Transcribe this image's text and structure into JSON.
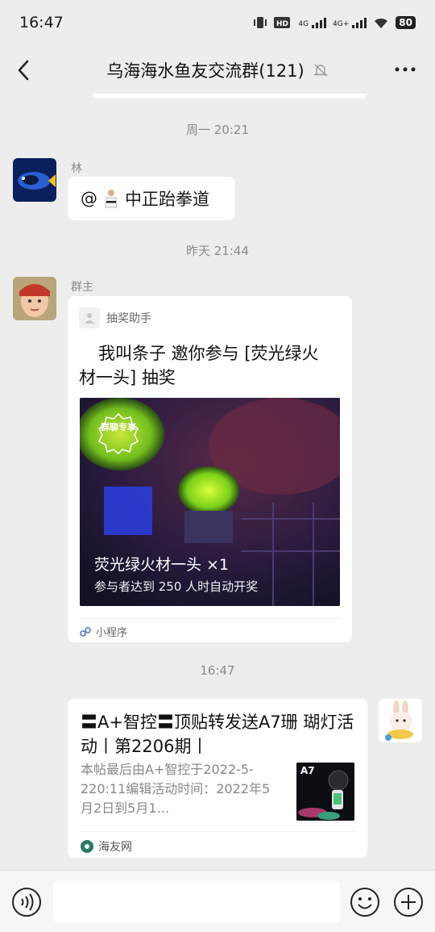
{
  "status": {
    "time": "16:47",
    "battery": "80",
    "net1": "4G",
    "net2": "4G+"
  },
  "chat": {
    "title": "乌海海水鱼友交流群(121)"
  },
  "timestamps": [
    "周一 20:21",
    "昨天 21:44",
    "16:47"
  ],
  "messages": {
    "msg1": {
      "sender": "林",
      "at": "@",
      "text": "中正跆拳道"
    },
    "msg2": {
      "sender": "群主",
      "app_name": "抽奖助手",
      "title_line1": "我叫条子 邀你参与 [荧光绿火",
      "title_line2": "材一头] 抽奖",
      "badge": "群聊专享",
      "prize": "荧光绿火材一头  ×1",
      "note": "参与者达到 250 人时自动开奖",
      "footer": "小程序"
    },
    "msg3": {
      "title": "〓A+智控〓顶贴转发送A7珊 瑚灯活动丨第2206期丨",
      "desc": "本帖最后由A+智控于2022-5-220:11编辑活动时间：2022年5月2日到5月1…",
      "thumb_label": "A7",
      "source": "海友网"
    }
  },
  "colors": {
    "background": "#ededed",
    "bubble": "#ffffff",
    "muted": "#8a8a8a"
  }
}
